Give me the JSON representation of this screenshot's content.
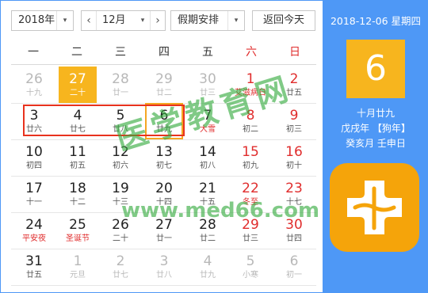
{
  "toolbar": {
    "year": "2018年",
    "month": "12月",
    "holiday": "假期安排",
    "today_button": "返回今天",
    "prev_label": "‹",
    "next_label": "›",
    "caret": "▾"
  },
  "weekdays": [
    "一",
    "二",
    "三",
    "四",
    "五",
    "六",
    "日"
  ],
  "weeks": [
    [
      {
        "n": "26",
        "l": "十九",
        "state": "other"
      },
      {
        "n": "27",
        "l": "二十",
        "state": "today"
      },
      {
        "n": "28",
        "l": "廿一",
        "state": "other"
      },
      {
        "n": "29",
        "l": "廿二",
        "state": "other"
      },
      {
        "n": "30",
        "l": "廿三",
        "state": "other"
      },
      {
        "n": "1",
        "l": "艾滋病日",
        "state": "fest"
      },
      {
        "n": "2",
        "l": "廿五",
        "state": "normal"
      }
    ],
    [
      {
        "n": "3",
        "l": "廿六",
        "state": "normal"
      },
      {
        "n": "4",
        "l": "廿七",
        "state": "normal"
      },
      {
        "n": "5",
        "l": "廿八",
        "state": "normal"
      },
      {
        "n": "6",
        "l": "廿九",
        "state": "sel"
      },
      {
        "n": "7",
        "l": "大雪",
        "state": "fest"
      },
      {
        "n": "8",
        "l": "初二",
        "state": "normal"
      },
      {
        "n": "9",
        "l": "初三",
        "state": "normal"
      }
    ],
    [
      {
        "n": "10",
        "l": "初四",
        "state": "normal"
      },
      {
        "n": "11",
        "l": "初五",
        "state": "normal"
      },
      {
        "n": "12",
        "l": "初六",
        "state": "normal"
      },
      {
        "n": "13",
        "l": "初七",
        "state": "normal"
      },
      {
        "n": "14",
        "l": "初八",
        "state": "normal"
      },
      {
        "n": "15",
        "l": "初九",
        "state": "normal"
      },
      {
        "n": "16",
        "l": "初十",
        "state": "normal"
      }
    ],
    [
      {
        "n": "17",
        "l": "十一",
        "state": "normal"
      },
      {
        "n": "18",
        "l": "十二",
        "state": "normal"
      },
      {
        "n": "19",
        "l": "十三",
        "state": "normal"
      },
      {
        "n": "20",
        "l": "十四",
        "state": "normal"
      },
      {
        "n": "21",
        "l": "十五",
        "state": "normal"
      },
      {
        "n": "22",
        "l": "冬至",
        "state": "fest"
      },
      {
        "n": "23",
        "l": "十七",
        "state": "normal"
      }
    ],
    [
      {
        "n": "24",
        "l": "平安夜",
        "state": "fest"
      },
      {
        "n": "25",
        "l": "圣诞节",
        "state": "fest"
      },
      {
        "n": "26",
        "l": "二十",
        "state": "normal"
      },
      {
        "n": "27",
        "l": "廿一",
        "state": "normal"
      },
      {
        "n": "28",
        "l": "廿二",
        "state": "normal"
      },
      {
        "n": "29",
        "l": "廿三",
        "state": "normal"
      },
      {
        "n": "30",
        "l": "廿四",
        "state": "normal"
      }
    ],
    [
      {
        "n": "31",
        "l": "廿五",
        "state": "normal"
      },
      {
        "n": "1",
        "l": "元旦",
        "state": "other"
      },
      {
        "n": "2",
        "l": "廿七",
        "state": "other"
      },
      {
        "n": "3",
        "l": "廿八",
        "state": "other"
      },
      {
        "n": "4",
        "l": "廿九",
        "state": "other"
      },
      {
        "n": "5",
        "l": "小寒",
        "state": "other"
      },
      {
        "n": "6",
        "l": "初一",
        "state": "other"
      }
    ]
  ],
  "side": {
    "date": "2018-12-06 星期四",
    "day": "6",
    "lunar": "十月廿九",
    "ganzhi_year": "戊戌年 【狗年】",
    "ganzhi_day": "癸亥月 壬申日"
  },
  "watermark": {
    "cn": "医学教育网",
    "url": "www.med66.com"
  },
  "colors": {
    "accent_blue": "#4e98f6",
    "today_orange": "#f7b51e",
    "holiday_red": "#e02d2d",
    "watermark_green": "#32aa3c"
  }
}
